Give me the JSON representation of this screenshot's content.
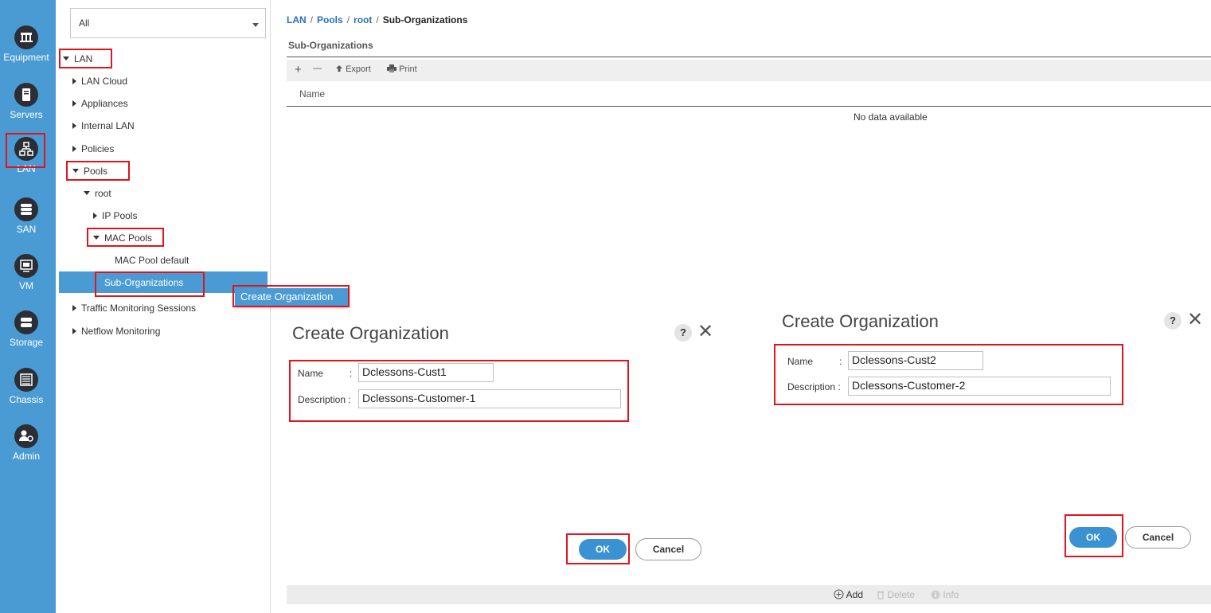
{
  "rail": {
    "items": [
      {
        "label": "Equipment",
        "icon": "equipment-icon"
      },
      {
        "label": "Servers",
        "icon": "servers-icon"
      },
      {
        "label": "LAN",
        "icon": "lan-icon"
      },
      {
        "label": "SAN",
        "icon": "san-icon"
      },
      {
        "label": "VM",
        "icon": "vm-icon"
      },
      {
        "label": "Storage",
        "icon": "storage-icon"
      },
      {
        "label": "Chassis",
        "icon": "chassis-icon"
      },
      {
        "label": "Admin",
        "icon": "admin-icon"
      }
    ]
  },
  "tree": {
    "filter": "All",
    "nodes": [
      "LAN",
      "LAN Cloud",
      "Appliances",
      "Internal LAN",
      "Policies",
      "Pools",
      "root",
      "IP Pools",
      "MAC Pools",
      "MAC Pool default",
      "Sub-Organizations",
      "Traffic Monitoring Sessions",
      "Netflow Monitoring"
    ]
  },
  "context_menu": {
    "item": "Create Organization"
  },
  "breadcrumb": [
    "LAN",
    "Pools",
    "root",
    "Sub-Organizations"
  ],
  "main": {
    "section_title": "Sub-Organizations",
    "toolbar": {
      "add": "+",
      "remove": "—",
      "export": "Export",
      "print": "Print"
    },
    "column_header": "Name",
    "empty_text": "No data available",
    "bottom": {
      "add": "Add",
      "delete": "Delete",
      "info": "Info"
    }
  },
  "dialog1": {
    "title": "Create Organization",
    "help": "?",
    "name_label": "Name",
    "colon": ":",
    "description_label": "Description :",
    "name_value": "Dclessons-Cust1",
    "description_value": "Dclessons-Customer-1",
    "ok": "OK",
    "cancel": "Cancel"
  },
  "dialog2": {
    "title": "Create Organization",
    "help": "?",
    "name_label": "Name",
    "colon": ":",
    "description_label": "Description :",
    "name_value": "Dclessons-Cust2",
    "description_value": "Dclessons-Customer-2",
    "ok": "OK",
    "cancel": "Cancel"
  },
  "colors": {
    "accent": "#4a9bd4",
    "highlight_box": "#e0141e",
    "ok_button": "#3b92d2"
  }
}
